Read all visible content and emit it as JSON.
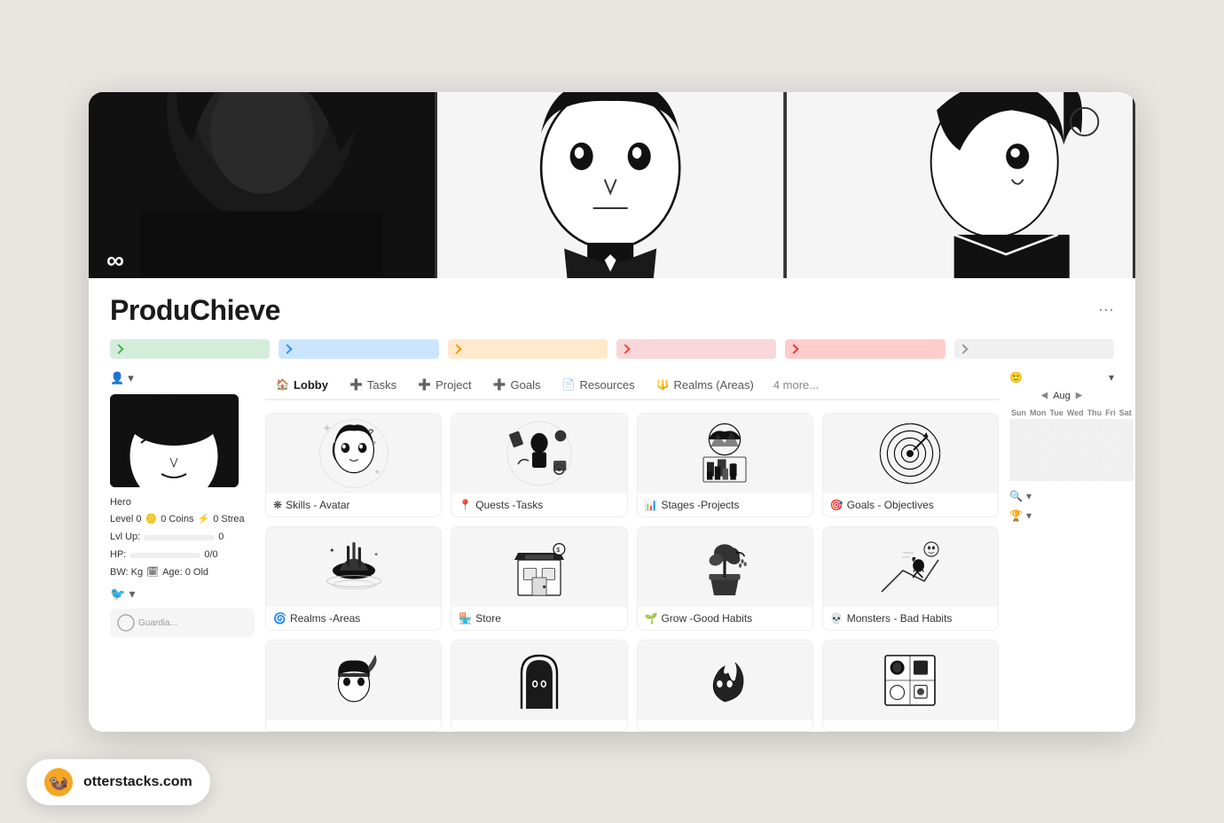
{
  "app": {
    "title": "ProduChieve",
    "site": "otterstacks.com"
  },
  "hero": {
    "panels": [
      "manga-left",
      "manga-center",
      "manga-right"
    ]
  },
  "progress_bars": [
    {
      "color": "green",
      "class": "pb-green"
    },
    {
      "color": "blue",
      "class": "pb-blue"
    },
    {
      "color": "orange",
      "class": "pb-orange"
    },
    {
      "color": "pink",
      "class": "pb-pink"
    },
    {
      "color": "red",
      "class": "pb-red"
    },
    {
      "color": "gray",
      "class": "pb-gray"
    }
  ],
  "tabs": [
    {
      "label": "Lobby",
      "icon": "🏠",
      "active": true
    },
    {
      "label": "Tasks",
      "icon": "➕",
      "active": false
    },
    {
      "label": "Project",
      "icon": "➕",
      "active": false
    },
    {
      "label": "Goals",
      "icon": "➕",
      "active": false
    },
    {
      "label": "Resources",
      "icon": "📄",
      "active": false
    },
    {
      "label": "Realms (Areas)",
      "icon": "🔱",
      "active": false
    },
    {
      "label": "4 more...",
      "icon": "",
      "active": false
    }
  ],
  "cards": [
    {
      "label": "Skills - Avatar",
      "icon": "❋",
      "img_type": "avatar"
    },
    {
      "label": "Quests -Tasks",
      "icon": "📍",
      "img_type": "quests"
    },
    {
      "label": "Stages -Projects",
      "icon": "📊",
      "img_type": "stages"
    },
    {
      "label": "Goals - Objectives",
      "icon": "🎯",
      "img_type": "goals"
    },
    {
      "label": "Realms -Areas",
      "icon": "🌀",
      "img_type": "realms"
    },
    {
      "label": "Store",
      "icon": "🏪",
      "img_type": "store"
    },
    {
      "label": "Grow -Good Habits",
      "icon": "🌱",
      "img_type": "habits"
    },
    {
      "label": "Monsters - Bad Habits",
      "icon": "💀",
      "img_type": "monsters"
    },
    {
      "label": "",
      "icon": "",
      "img_type": "extra1"
    },
    {
      "label": "",
      "icon": "",
      "img_type": "extra2"
    },
    {
      "label": "",
      "icon": "",
      "img_type": "extra3"
    },
    {
      "label": "",
      "icon": "",
      "img_type": "extra4"
    }
  ],
  "character": {
    "role": "Hero",
    "level": "Level 0",
    "coins": "0 Coins",
    "streak": "0 Strea",
    "lvlup_label": "Lvl Up:",
    "hp_label": "HP:",
    "hp_value": "0/0",
    "bw_label": "BW: Kg",
    "age_label": "Age: 0 Old"
  },
  "calendar": {
    "month": "Aug",
    "days": [
      "Sun",
      "Mon",
      "Tue",
      "Wed",
      "Thu",
      "Fri",
      "Sat"
    ],
    "weeks": [
      [
        "",
        "",
        "",
        "",
        "",
        "",
        ""
      ],
      [
        "",
        "",
        "",
        "",
        "",
        "",
        ""
      ],
      [
        "",
        "",
        "",
        "",
        "",
        "",
        ""
      ],
      [
        "",
        "",
        "",
        "",
        "",
        "",
        ""
      ],
      [
        "",
        "",
        "",
        "",
        "",
        "",
        ""
      ]
    ]
  },
  "bottom_bar": {
    "site_label": "otterstacks.com"
  }
}
